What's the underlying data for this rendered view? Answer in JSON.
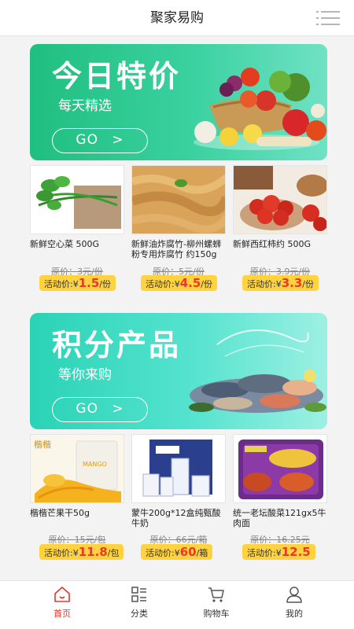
{
  "header": {
    "title": "聚家易购",
    "menu_icon": "menu-icon"
  },
  "banners": [
    {
      "title": "今日特价",
      "subtitle": "每天精选",
      "go": "GO",
      "arrow": ">"
    },
    {
      "title": "积分产品",
      "subtitle": "等你来购",
      "go": "GO",
      "arrow": ">"
    }
  ],
  "products_row1": [
    {
      "name": "新鲜空心菜 500G",
      "original": "原价：3元/份",
      "promo_prefix": "活动价:¥",
      "promo_value": "1.5",
      "promo_unit": "/份"
    },
    {
      "name": "新鲜油炸腐竹-柳州螺蛳粉专用炸腐竹 约150g",
      "original": "原价：5元/份",
      "promo_prefix": "活动价:¥",
      "promo_value": "4.5",
      "promo_unit": "/份"
    },
    {
      "name": "新鲜西红柿约 500G",
      "original": "原价：3.9元/份",
      "promo_prefix": "活动价:¥",
      "promo_value": "3.3",
      "promo_unit": "/份"
    }
  ],
  "products_row2": [
    {
      "name": "楷楷芒果干50g",
      "original": "原价：15元/包",
      "promo_prefix": "活动价:¥",
      "promo_value": "11.8",
      "promo_unit": "/包"
    },
    {
      "name": "蒙牛200g*12盒纯甄酸牛奶",
      "original": "原价：66元/箱",
      "promo_prefix": "活动价:¥",
      "promo_value": "60",
      "promo_unit": "/箱"
    },
    {
      "name": "统一老坛酸菜121gx5牛肉面",
      "original": "原价：16.25元",
      "promo_prefix": "活动价:¥",
      "promo_value": "12.5",
      "promo_unit": ""
    }
  ],
  "tabs": [
    {
      "label": "首页",
      "icon": "home-icon",
      "active": true
    },
    {
      "label": "分类",
      "icon": "category-icon",
      "active": false
    },
    {
      "label": "购物车",
      "icon": "cart-icon",
      "active": false
    },
    {
      "label": "我的",
      "icon": "user-icon",
      "active": false
    }
  ],
  "colors": {
    "accent": "#e5372b",
    "promo_bg": "#ffd23f",
    "price_red": "#e83a24"
  }
}
